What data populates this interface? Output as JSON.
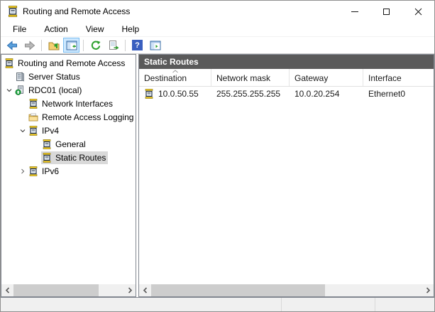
{
  "window": {
    "title": "Routing and Remote Access"
  },
  "menu": {
    "items": [
      "File",
      "Action",
      "View",
      "Help"
    ]
  },
  "toolbar": {
    "buttons": [
      {
        "name": "back"
      },
      {
        "name": "forward"
      },
      {
        "name": "up-one-level"
      },
      {
        "name": "show-hide-console-tree",
        "active": true
      },
      {
        "name": "refresh"
      },
      {
        "name": "export-list"
      },
      {
        "name": "help"
      },
      {
        "name": "show-hide-action-pane"
      }
    ],
    "help_glyph": "?"
  },
  "tree": {
    "items": [
      {
        "label": "Routing and Remote Access",
        "level": 0,
        "icon": "rras-router",
        "chevron": null,
        "selected": false
      },
      {
        "label": "Server Status",
        "level": 1,
        "icon": "server-stack",
        "chevron": null,
        "selected": false
      },
      {
        "label": "RDC01 (local)",
        "level": 1,
        "icon": "server-local",
        "chevron": "expanded",
        "selected": false
      },
      {
        "label": "Network Interfaces",
        "level": 2,
        "icon": "rras-router",
        "chevron": null,
        "selected": false
      },
      {
        "label": "Remote Access Logging",
        "level": 2,
        "icon": "folder",
        "chevron": null,
        "selected": false
      },
      {
        "label": "IPv4",
        "level": 2,
        "icon": "rras-router",
        "chevron": "expanded",
        "selected": false
      },
      {
        "label": "General",
        "level": 3,
        "icon": "rras-router",
        "chevron": null,
        "selected": false
      },
      {
        "label": "Static Routes",
        "level": 3,
        "icon": "rras-router",
        "chevron": null,
        "selected": true
      },
      {
        "label": "IPv6",
        "level": 2,
        "icon": "rras-router",
        "chevron": "collapsed",
        "selected": false
      }
    ]
  },
  "main": {
    "header": "Static Routes",
    "columns": [
      "Destination",
      "Network mask",
      "Gateway",
      "Interface"
    ],
    "sort": {
      "column": "Destination",
      "direction": "ascending"
    },
    "rows": [
      {
        "destination": "10.0.50.55",
        "network_mask": "255.255.255.255",
        "gateway": "10.0.20.254",
        "interface": "Ethernet0"
      }
    ]
  },
  "colors": {
    "pane_header_bg": "#5a5a5a",
    "selection_bg": "#d9d9d9",
    "toolbar_toggle_bg": "#cde8ff",
    "toolbar_toggle_border": "#79bcf0",
    "status_bar_bg": "#f0f0f0"
  }
}
